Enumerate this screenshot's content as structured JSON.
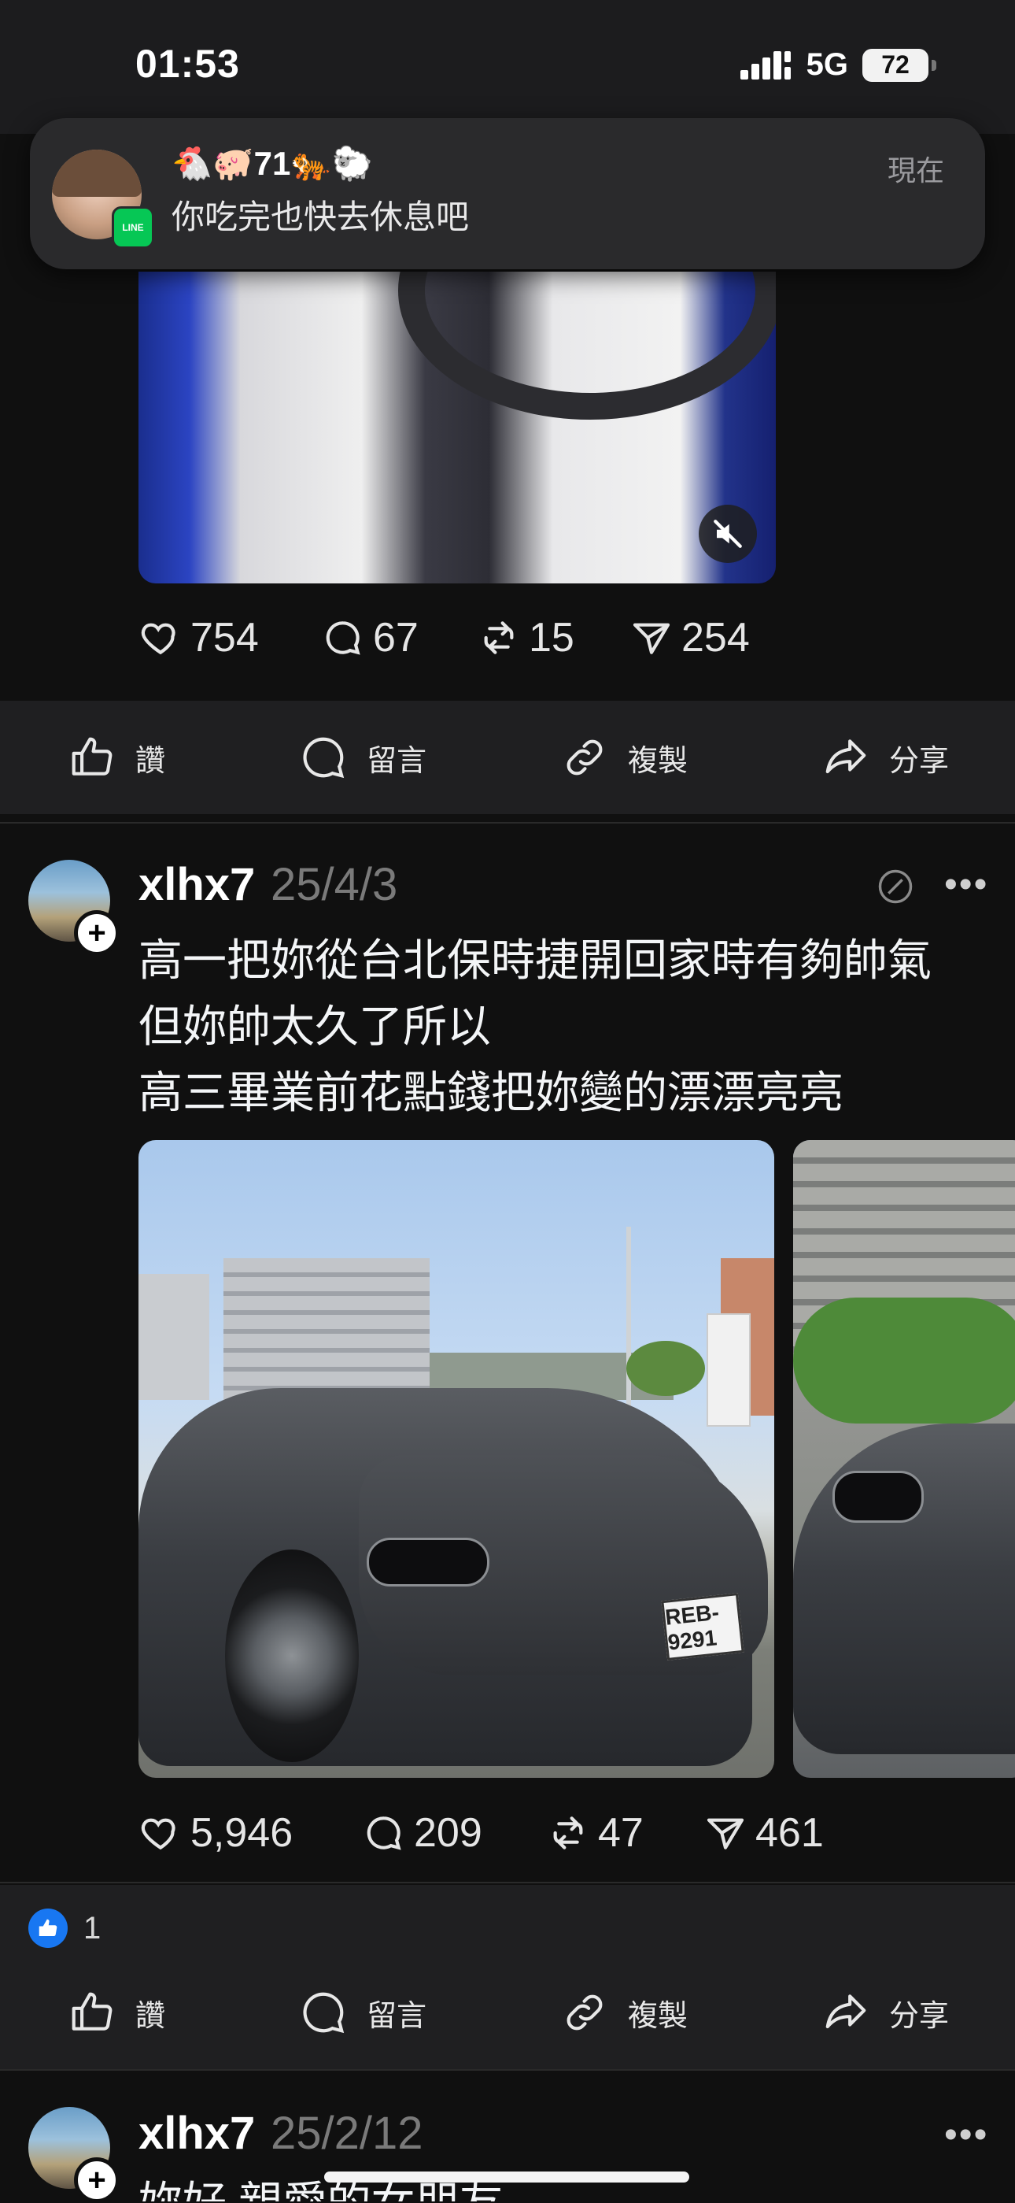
{
  "status_bar": {
    "time": "01:53",
    "network": "5G",
    "battery": "72"
  },
  "notification": {
    "app_badge": "LINE",
    "title": "🐔🐖71🐅🐑",
    "body": "你吃完也快去休息吧",
    "time": "現在"
  },
  "post_top": {
    "stats": {
      "likes": "754",
      "comments": "67",
      "reposts": "15",
      "shares": "254"
    }
  },
  "action_bar": {
    "like": "讚",
    "comment": "留言",
    "copy": "複製",
    "share": "分享"
  },
  "post_1": {
    "username": "xlhx7",
    "date": "25/4/3",
    "text_lines": [
      "高一把妳從台北保時捷開回家時有夠帥氣",
      "但妳帥太久了所以",
      "高三畢業前花點錢把妳變的漂漂亮亮"
    ],
    "plate": "REB-9291",
    "stats": {
      "likes": "5,946",
      "comments": "209",
      "reposts": "47",
      "shares": "461"
    },
    "reaction_count": "1"
  },
  "post_2": {
    "username": "xlhx7",
    "date": "25/2/12",
    "text_partial": "妳好 親愛的女朋友"
  },
  "colors": {
    "accent_like": "#1877f2",
    "line_green": "#06c755",
    "background": "#101010"
  }
}
